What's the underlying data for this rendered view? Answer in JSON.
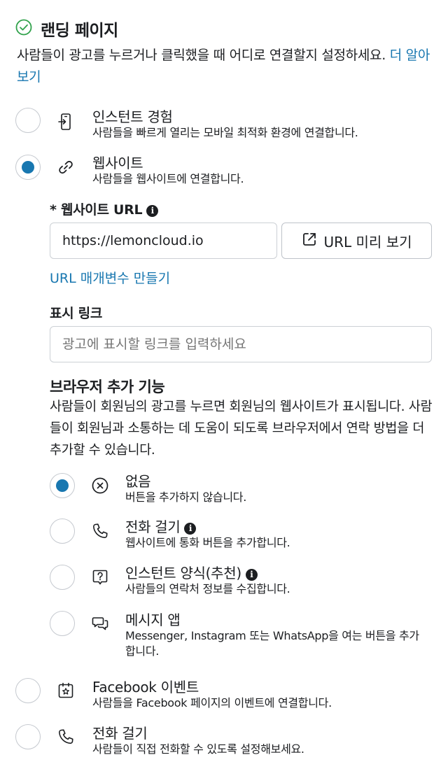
{
  "header": {
    "title": "랜딩 페이지",
    "description": "사람들이 광고를 누르거나 클릭했을 때 어디로 연결할지 설정하세요.",
    "learn_more": "더 알아보기"
  },
  "destinations": [
    {
      "title": "인스턴트 경험",
      "desc": "사람들을 빠르게 열리는 모바일 최적화 환경에 연결합니다.",
      "icon": "instant-experience-icon",
      "selected": false
    },
    {
      "title": "웹사이트",
      "desc": "사람들을 웹사이트에 연결합니다.",
      "icon": "link-icon",
      "selected": true
    },
    {
      "title": "Facebook 이벤트",
      "desc": "사람들을 Facebook 페이지의 이벤트에 연결합니다.",
      "icon": "event-icon",
      "selected": false
    },
    {
      "title": "전화 걸기",
      "desc": "사람들이 직접 전화할 수 있도록 설정해보세요.",
      "icon": "phone-icon",
      "selected": false
    }
  ],
  "website": {
    "url_label": "* 웹사이트 URL",
    "url_value": "https://lemoncloud.io",
    "preview_button": "URL 미리 보기",
    "params_link": "URL 매개변수 만들기",
    "display_link_label": "표시 링크",
    "display_link_placeholder": "광고에 표시할 링크를 입력하세요"
  },
  "browser_addons": {
    "title": "브라우저 추가 기능",
    "description": "사람들이 회원님의 광고를 누르면 회원님의 웹사이트가 표시됩니다. 사람들이 회원님과 소통하는 데 도움이 되도록 브라우저에서 연락 방법을 더 추가할 수 있습니다.",
    "options": [
      {
        "title": "없음",
        "desc": "버튼을 추가하지 않습니다.",
        "icon": "none-icon",
        "info": false,
        "selected": true
      },
      {
        "title": "전화 걸기",
        "desc": "웹사이트에 통화 버튼을 추가합니다.",
        "icon": "phone-icon",
        "info": true,
        "selected": false
      },
      {
        "title": "인스턴트 양식(추천)",
        "desc": "사람들의 연락처 정보를 수집합니다.",
        "icon": "question-form-icon",
        "info": true,
        "selected": false
      },
      {
        "title": "메시지 앱",
        "desc": "Messenger, Instagram 또는 WhatsApp을 여는 버튼을 추가합니다.",
        "icon": "chat-icon",
        "info": false,
        "selected": false
      }
    ]
  },
  "colors": {
    "accent": "#1877b0",
    "success": "#31a24c",
    "border": "#ccd0d5",
    "text": "#1c1e21"
  }
}
